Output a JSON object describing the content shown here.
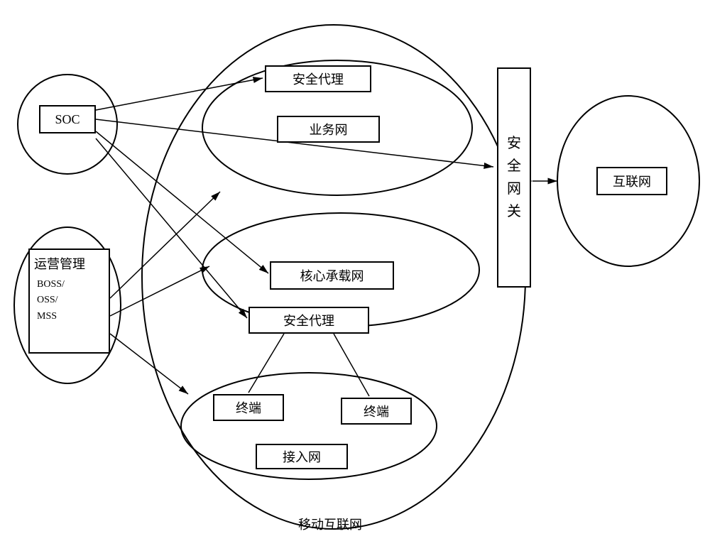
{
  "boxes": {
    "soc": "SOC",
    "ops_title": "运营管理",
    "ops_sub1": "BOSS/",
    "ops_sub2": "OSS/",
    "ops_sub3": "MSS",
    "sec_proxy_top": "安全代理",
    "biz_net": "业务网",
    "core_net": "核心承载网",
    "sec_proxy_mid": "安全代理",
    "terminal1": "终端",
    "terminal2": "终端",
    "access_net": "接入网",
    "sec_gateway": "安全网关",
    "internet": "互联网"
  },
  "labels": {
    "mobile_internet": "移动互联网"
  }
}
